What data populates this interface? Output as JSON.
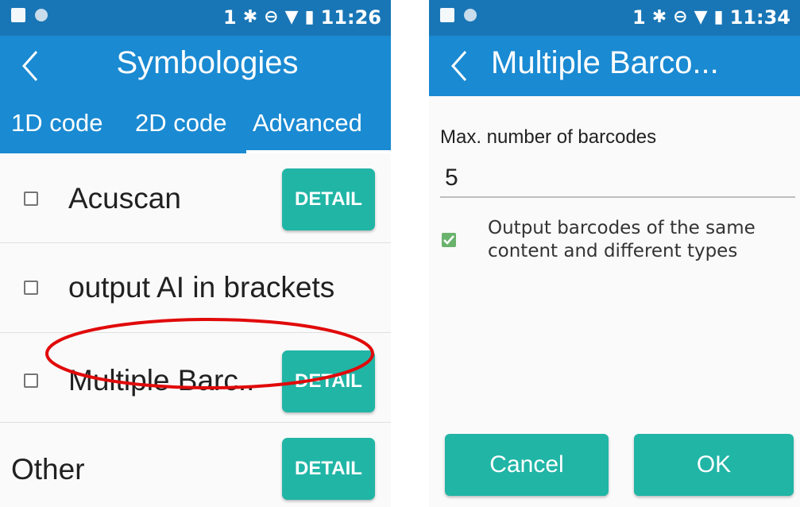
{
  "left": {
    "status": {
      "sim": "1",
      "time": "11:26"
    },
    "title": "Symbologies",
    "tabs": [
      {
        "label": "1D code",
        "active": false
      },
      {
        "label": "2D code",
        "active": false
      },
      {
        "label": "Advanced",
        "active": true
      }
    ],
    "rows": [
      {
        "label": "Acuscan",
        "checked": false,
        "button": "DETAIL"
      },
      {
        "label": "output AI in brackets",
        "checked": false
      },
      {
        "label": "Multiple Barc..",
        "checked": false,
        "button": "DETAIL",
        "highlighted": true
      },
      {
        "label": "Other",
        "button": "DETAIL"
      }
    ]
  },
  "right": {
    "status": {
      "sim": "1",
      "time": "11:34"
    },
    "title": "Multiple Barco...",
    "field": {
      "label": "Max. number of barcodes",
      "value": "5"
    },
    "checkbox": {
      "line1": "Output barcodes of the same",
      "line2": "content and different types",
      "checked": true
    },
    "buttons": {
      "cancel": "Cancel",
      "ok": "OK"
    }
  },
  "colors": {
    "statusbar": "#1976b6",
    "toolbar": "#1a8ad2",
    "button": "#21b5a6",
    "annotation": "#e10a0a",
    "checkbox_checked": "#6ab36c"
  },
  "icons": [
    "back-arrow-icon",
    "bluetooth-icon",
    "do-not-disturb-icon",
    "wifi-icon",
    "battery-icon",
    "check-icon"
  ]
}
